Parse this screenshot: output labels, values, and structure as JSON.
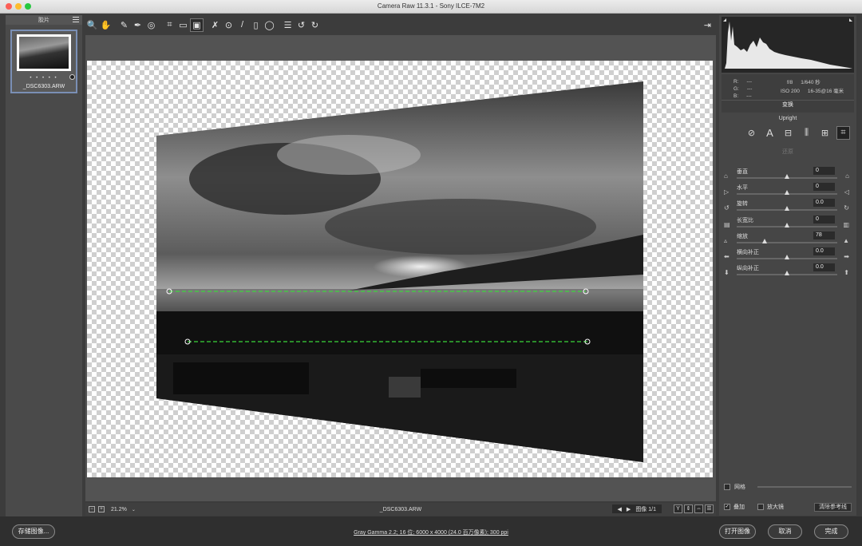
{
  "window": {
    "title": "Camera Raw 11.3.1 -  Sony ILCE-7M2"
  },
  "filmstrip": {
    "header": "胶片",
    "thumbnail": {
      "filename": "_DSC6303.ARW",
      "rating_dots": "• • • • •"
    }
  },
  "toolbar": {
    "tools": [
      {
        "name": "zoom-tool",
        "glyph": "🔍"
      },
      {
        "name": "hand-tool",
        "glyph": "✋"
      },
      {
        "name": "white-balance-tool",
        "glyph": "✎"
      },
      {
        "name": "color-sampler-tool",
        "glyph": "✒"
      },
      {
        "name": "targeted-adjustment-tool",
        "glyph": "◎"
      },
      {
        "name": "crop-tool",
        "glyph": "⌗"
      },
      {
        "name": "straighten-tool",
        "glyph": "▭"
      },
      {
        "name": "transform-tool",
        "glyph": "▣"
      },
      {
        "name": "spot-removal-tool",
        "glyph": "✗"
      },
      {
        "name": "red-eye-tool",
        "glyph": "⊙"
      },
      {
        "name": "adjustment-brush-tool",
        "glyph": "/"
      },
      {
        "name": "graduated-filter-tool",
        "glyph": "▯"
      },
      {
        "name": "radial-filter-tool",
        "glyph": "◯"
      },
      {
        "name": "preferences-tool",
        "glyph": "☰"
      },
      {
        "name": "rotate-ccw-tool",
        "glyph": "↺"
      },
      {
        "name": "rotate-cw-tool",
        "glyph": "↻"
      }
    ],
    "right_icon": "⇥"
  },
  "canvasbar": {
    "zoom": "21.2%",
    "filename": "_DSC6303.ARW",
    "image_counter": "图像 1/1"
  },
  "info": {
    "rgb": [
      {
        "label": "R:",
        "value": "---"
      },
      {
        "label": "G:",
        "value": "---"
      },
      {
        "label": "B:",
        "value": "---"
      }
    ],
    "aperture": "f/8",
    "shutter": "1/640 秒",
    "iso": "ISO 200",
    "lens": "16-35@16 毫米"
  },
  "panel": {
    "tab": "变换",
    "upright_label": "Upright",
    "revert": "还原",
    "sliders": [
      {
        "label": "垂直",
        "value": "0",
        "pos": 0.5,
        "icon_l": "⌂",
        "icon_r": "⌂"
      },
      {
        "label": "水平",
        "value": "0",
        "pos": 0.5,
        "icon_l": "▷",
        "icon_r": "◁"
      },
      {
        "label": "旋转",
        "value": "0.0",
        "pos": 0.5,
        "icon_l": "↺",
        "icon_r": "↻"
      },
      {
        "label": "长宽比",
        "value": "0",
        "pos": 0.5,
        "icon_l": "▤",
        "icon_r": "▥"
      },
      {
        "label": "缩放",
        "value": "78",
        "pos": 0.28,
        "icon_l": "▵",
        "icon_r": "▲"
      },
      {
        "label": "横向补正",
        "value": "0.0",
        "pos": 0.5,
        "icon_l": "⬅",
        "icon_r": "➡"
      },
      {
        "label": "纵向补正",
        "value": "0.0",
        "pos": 0.5,
        "icon_l": "⬇",
        "icon_r": "⬆"
      }
    ],
    "grid_label": "网格",
    "overlay_label": "叠加",
    "loupe_label": "放大镜",
    "clear_guides": "清除参考线"
  },
  "bottom": {
    "save": "存储图像...",
    "workflow": "Gray Gamma 2.2; 16 位; 6000 x 4000 (24.0 百万像素); 300 ppi",
    "open": "打开图像",
    "cancel": "取消",
    "done": "完成"
  },
  "colors": {
    "guide_line": "#3bd63b",
    "accent": "#7a8fb5"
  }
}
